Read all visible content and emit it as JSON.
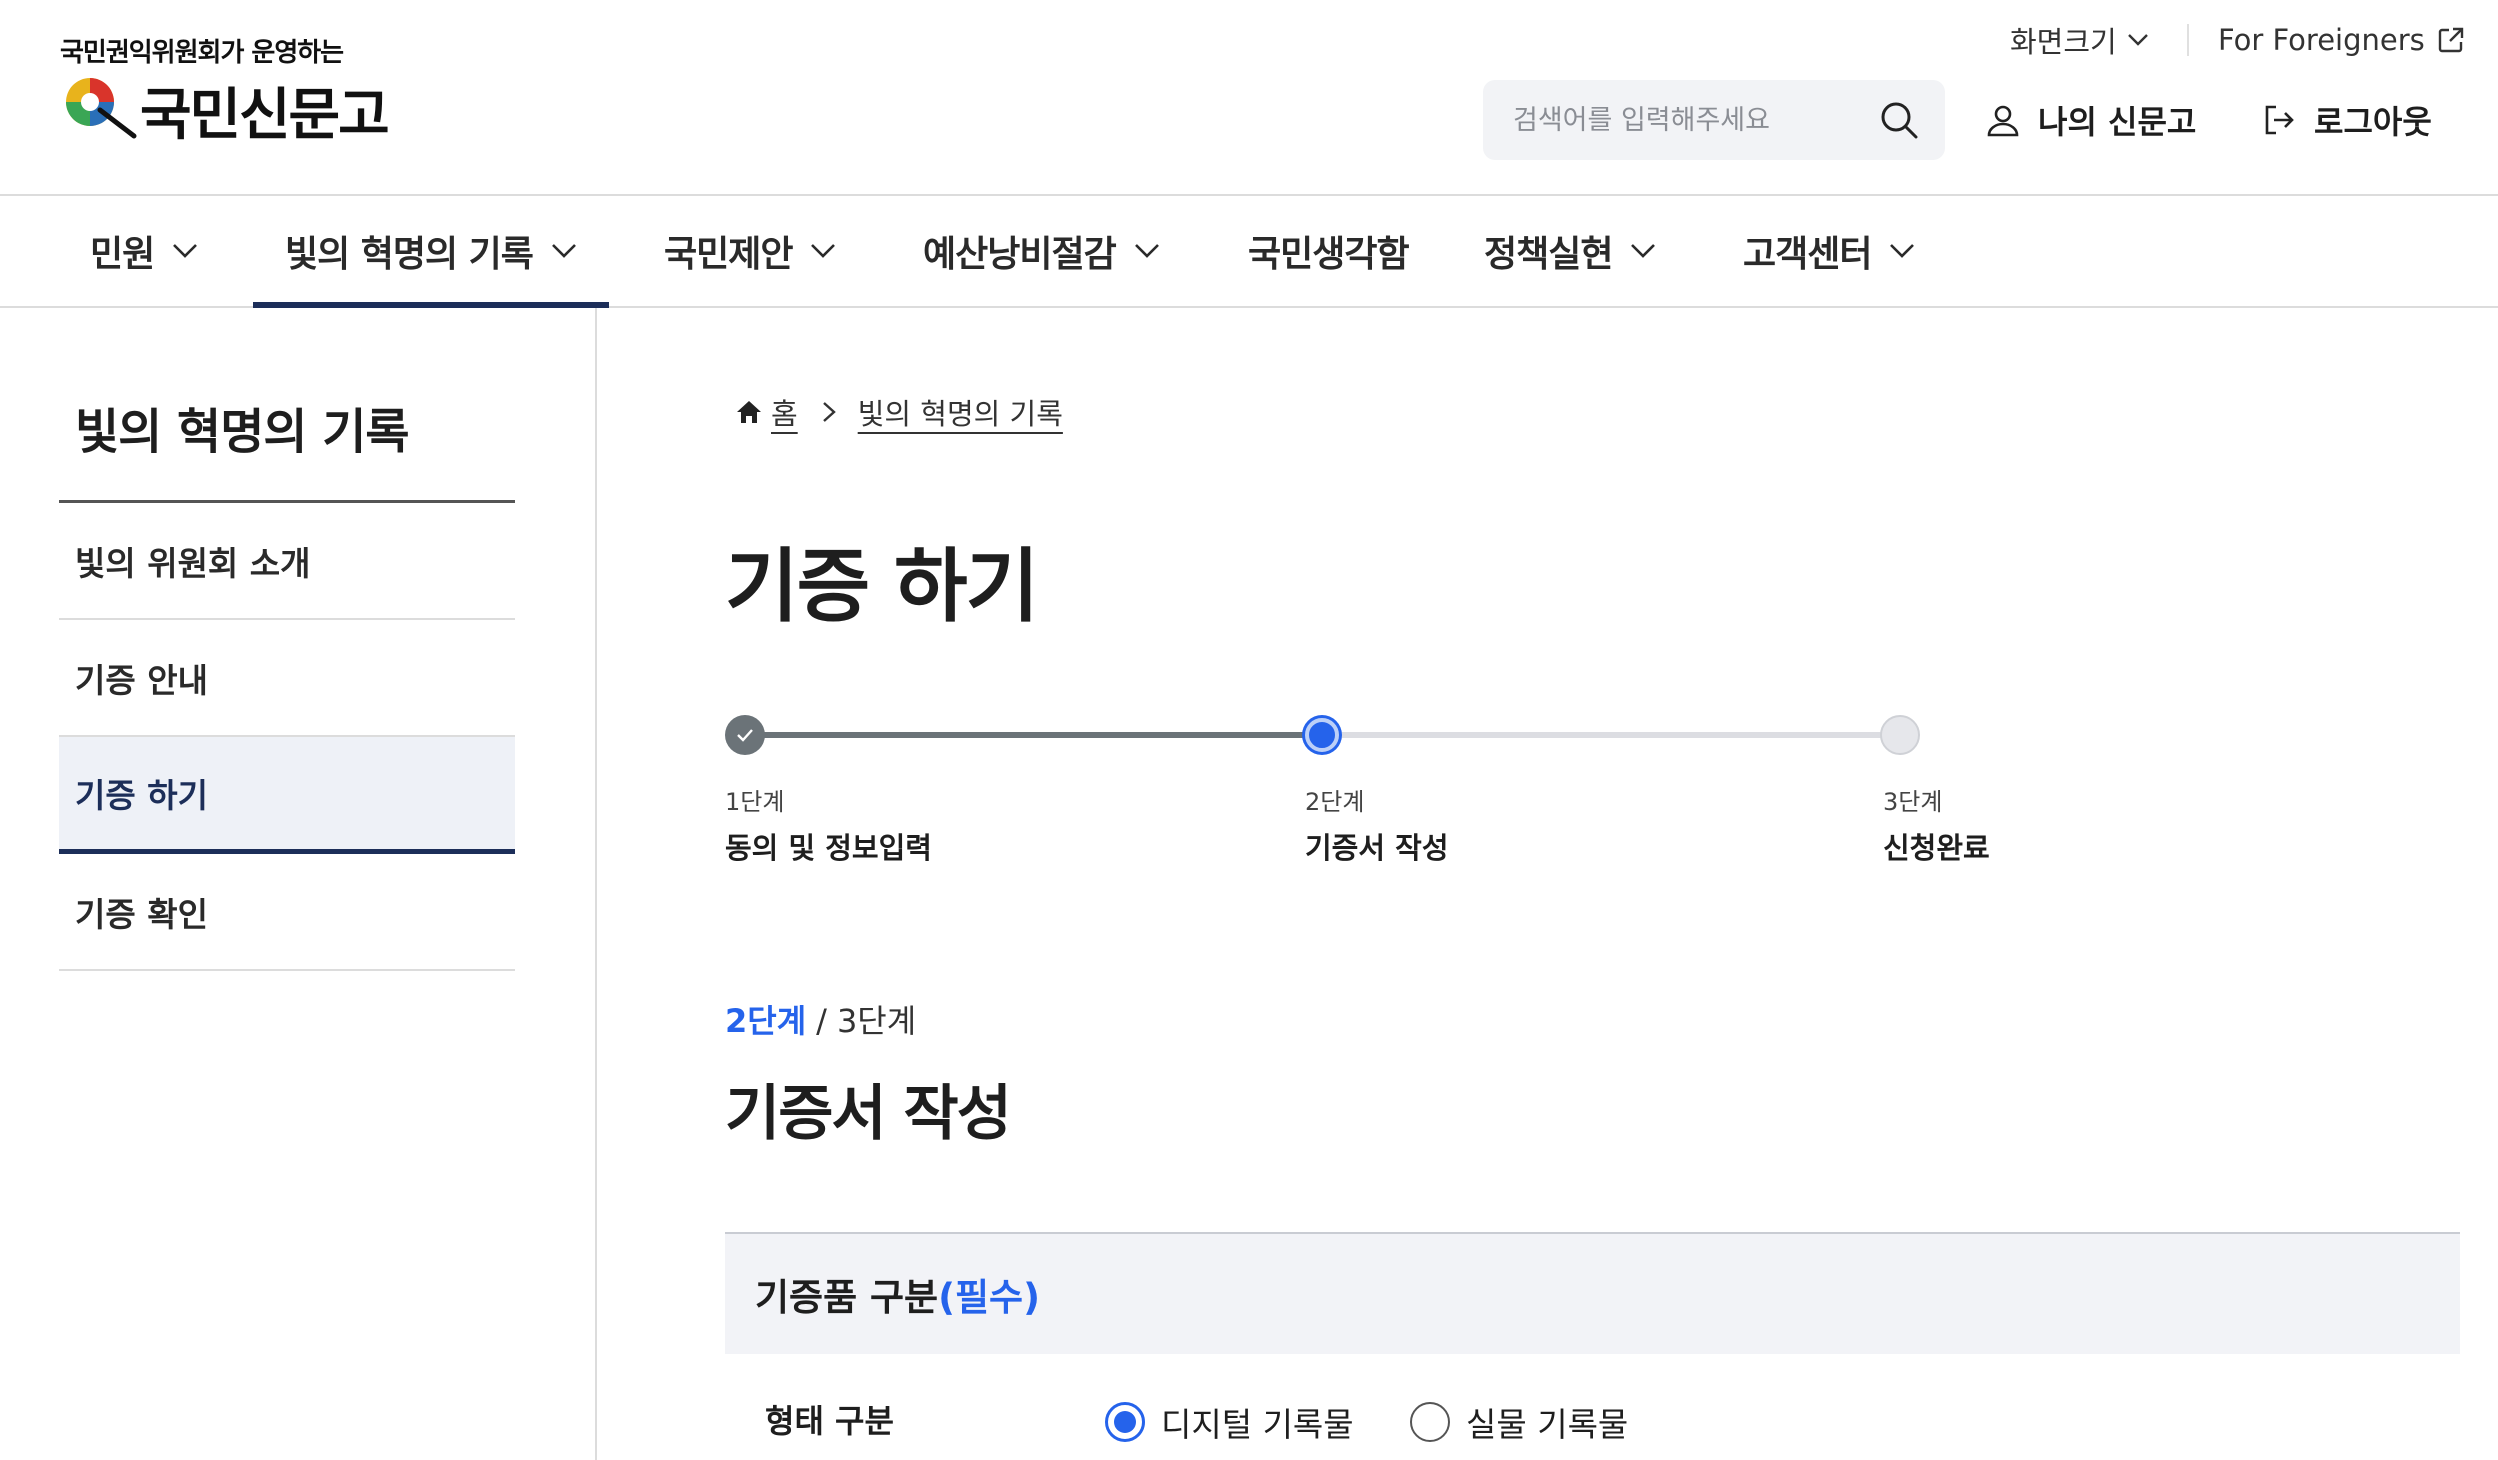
{
  "header": {
    "logo_subtitle": "국민권익위원회가 운영하는",
    "logo_name": "국민신문고",
    "screen_size_label": "화면크기",
    "foreigners_label": "For Foreigners",
    "search_placeholder": "검색어를 입력해주세요",
    "mypage_label": "나의 신문고",
    "logout_label": "로그아웃"
  },
  "gnb": {
    "items": [
      {
        "label": "민원",
        "has_dropdown": true
      },
      {
        "label": "빛의 혁명의 기록",
        "has_dropdown": true,
        "active": true
      },
      {
        "label": "국민제안",
        "has_dropdown": true
      },
      {
        "label": "예산낭비절감",
        "has_dropdown": true
      },
      {
        "label": "국민생각함",
        "has_dropdown": false
      },
      {
        "label": "정책실현",
        "has_dropdown": true
      },
      {
        "label": "고객센터",
        "has_dropdown": true
      }
    ]
  },
  "lnb": {
    "title": "빛의 혁명의 기록",
    "items": [
      {
        "label": "빛의 위원회 소개"
      },
      {
        "label": "기증 안내"
      },
      {
        "label": "기증 하기",
        "active": true
      },
      {
        "label": "기증 확인"
      }
    ]
  },
  "breadcrumb": {
    "home": "홈",
    "current": "빛의 혁명의 기록"
  },
  "page_title": "기증 하기",
  "stepper": {
    "steps": [
      {
        "num": "1단계",
        "name": "동의 및 정보입력",
        "state": "done"
      },
      {
        "num": "2단계",
        "name": "기증서 작성",
        "state": "current"
      },
      {
        "num": "3단계",
        "name": "신청완료",
        "state": "todo"
      }
    ]
  },
  "step_count": {
    "current": "2단계",
    "separator": "/",
    "total": "3단계"
  },
  "section_title": "기증서 작성",
  "form": {
    "group_label": "기증품 구분",
    "required_label": "(필수)",
    "row_label": "형태 구분",
    "options": [
      {
        "label": "디지털 기록물",
        "checked": true
      },
      {
        "label": "실물 기록물",
        "checked": false
      }
    ]
  },
  "colors": {
    "navy": "#1c2e59",
    "accent_blue": "#2563eb",
    "step_done": "#6b7378"
  }
}
